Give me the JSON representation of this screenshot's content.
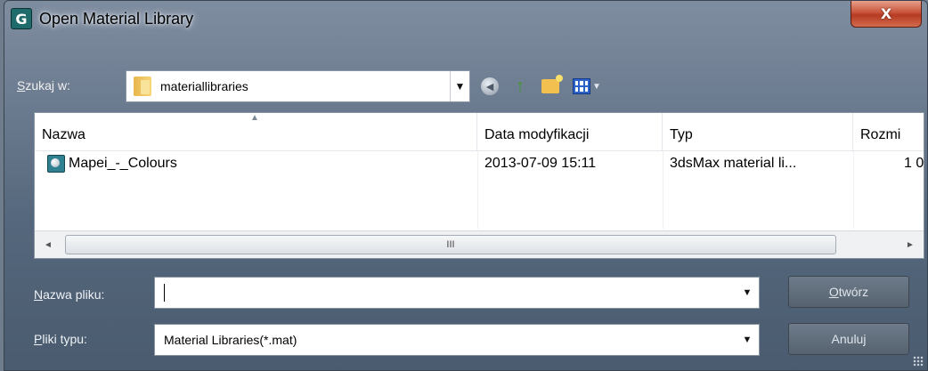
{
  "window": {
    "title": "Open Material Library",
    "close_label": "X"
  },
  "lookin": {
    "label_first": "S",
    "label_rest": "zukaj w:",
    "value": "materiallibraries"
  },
  "toolbar": {
    "icons": [
      "back-icon",
      "up-folder-icon",
      "new-folder-icon",
      "view-menu-icon"
    ]
  },
  "filelist": {
    "columns": [
      "Nazwa",
      "Data modyfikacji",
      "Typ",
      "Rozmi"
    ],
    "rows": [
      {
        "name": "Mapei_-_Colours",
        "modified": "2013-07-09 15:11",
        "type": "3dsMax material li...",
        "size": "1 0"
      }
    ],
    "scroll_grip": "III"
  },
  "filename": {
    "label_first": "N",
    "label_rest": "azwa pliku:",
    "value": ""
  },
  "filetype": {
    "label_first": "P",
    "label_rest": "liki typu:",
    "value": "Material Libraries(*.mat)"
  },
  "buttons": {
    "open_first": "O",
    "open_rest": "twórz",
    "cancel": "Anuluj"
  },
  "colors": {
    "title_bg": "#6f7f93",
    "close_red": "#c9533b",
    "list_bg": "#ffffff"
  }
}
